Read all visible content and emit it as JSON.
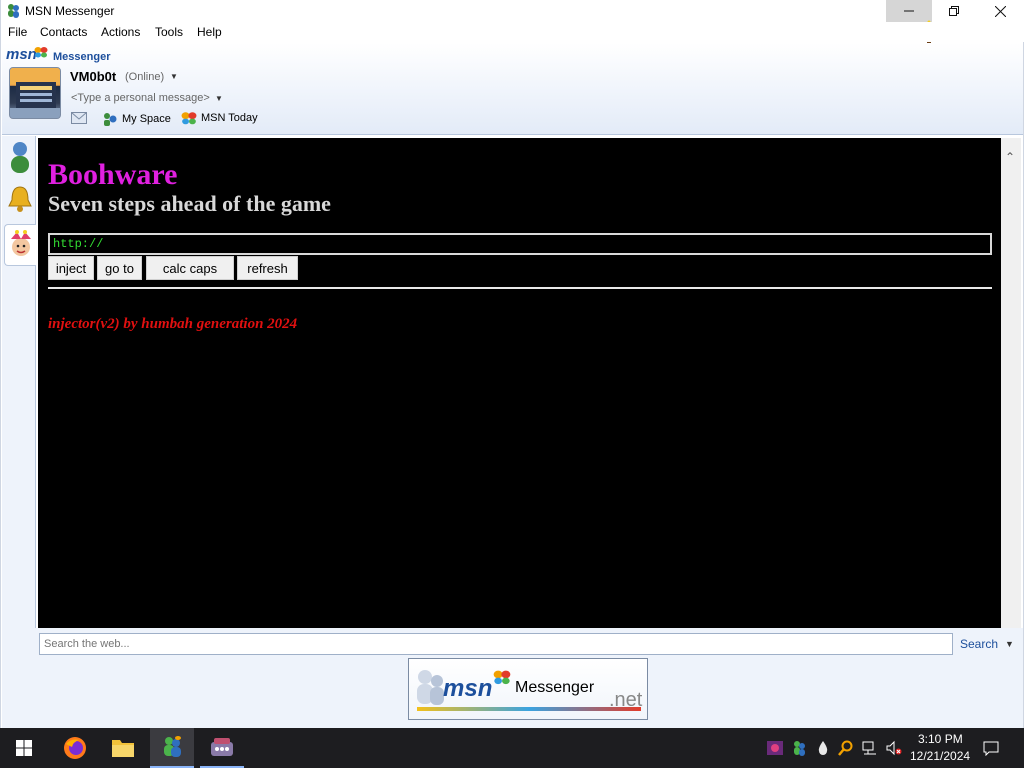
{
  "window": {
    "title": "MSN Messenger",
    "caption_buttons": {
      "minimize": "–",
      "maximize": "❐",
      "close": "✕"
    }
  },
  "menu": [
    "File",
    "Contacts",
    "Actions",
    "Tools",
    "Help"
  ],
  "header": {
    "logo_text": "msn",
    "product": "Messenger",
    "user_name": "VM0b0t",
    "status": "(Online)",
    "personal_message": "<Type a personal message>",
    "links": {
      "my_space": "My Space",
      "msn_today": "MSN Today"
    }
  },
  "content": {
    "title": "Boohware",
    "subtitle": "Seven steps ahead of the game",
    "url_value": "http://",
    "buttons": {
      "inject": "inject",
      "go_to": "go to",
      "calc_caps": "calc caps",
      "refresh": "refresh"
    },
    "credit": "injector(v2) by humbah generation 2024",
    "colors": {
      "title": "#e020e0",
      "subtitle": "#d8d8d8",
      "url_text": "#33dd33",
      "credit": "#e01010",
      "background": "#000000"
    }
  },
  "search": {
    "placeholder": "Search the web...",
    "button": "Search"
  },
  "banner": {
    "msn": "msn",
    "messenger": "Messenger",
    "net": ".net"
  },
  "taskbar": {
    "time": "3:10 PM",
    "date": "12/21/2024",
    "apps": [
      "start-icon",
      "firefox-icon",
      "file-explorer-icon",
      "msn-messenger-icon",
      "app-icon"
    ]
  }
}
